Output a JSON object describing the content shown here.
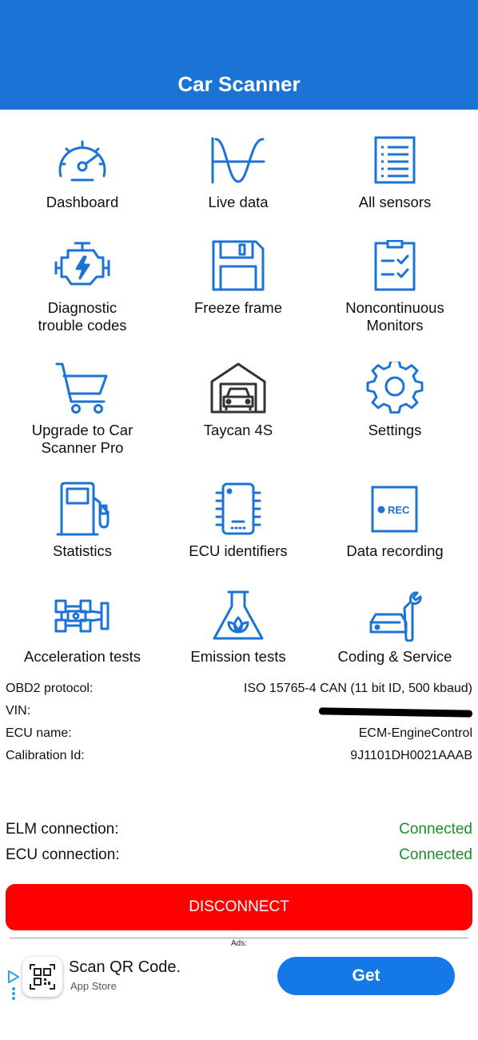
{
  "header": {
    "title": "Car Scanner"
  },
  "menu": [
    {
      "label": "Dashboard",
      "icon": "speedometer-icon"
    },
    {
      "label": "Live data",
      "icon": "waveform-icon"
    },
    {
      "label": "All sensors",
      "icon": "list-icon"
    },
    {
      "label": "Diagnostic trouble codes",
      "icon": "engine-icon"
    },
    {
      "label": "Freeze frame",
      "icon": "floppy-disk-icon"
    },
    {
      "label": "Noncontinuous Monitors",
      "icon": "clipboard-checklist-icon"
    },
    {
      "label": "Upgrade to Car Scanner Pro",
      "icon": "shopping-cart-icon"
    },
    {
      "label": "Taycan 4S",
      "icon": "garage-car-icon"
    },
    {
      "label": "Settings",
      "icon": "gear-icon"
    },
    {
      "label": "Statistics",
      "icon": "fuel-pump-icon"
    },
    {
      "label": "ECU identifiers",
      "icon": "chip-icon"
    },
    {
      "label": "Data recording",
      "icon": "rec-icon"
    },
    {
      "label": "Acceleration tests",
      "icon": "race-car-icon"
    },
    {
      "label": "Emission tests",
      "icon": "flask-leaf-icon"
    },
    {
      "label": "Coding & Service",
      "icon": "car-wrench-icon"
    }
  ],
  "rec_text": "REC",
  "vehicle_info": {
    "protocol_label": "OBD2 protocol:",
    "protocol_value": "ISO 15765-4 CAN (11 bit ID, 500 kbaud)",
    "vin_label": "VIN:",
    "ecu_name_label": "ECU name:",
    "ecu_name_value": "ECM-EngineControl",
    "calibration_label": "Calibration Id:",
    "calibration_value": "9J1101DH0021AAAB"
  },
  "connection": {
    "elm_label": "ELM connection:",
    "elm_status": "Connected",
    "ecu_label": "ECU connection:",
    "ecu_status": "Connected"
  },
  "disconnect_label": "DISCONNECT",
  "ads": {
    "label": "Ads:",
    "title": "Scan QR Code.",
    "subtitle": "App Store",
    "cta": "Get"
  },
  "colors": {
    "primary": "#1c73d6",
    "connected": "#1e8c2a",
    "danger": "#ff0000",
    "cta": "#1479e6"
  }
}
